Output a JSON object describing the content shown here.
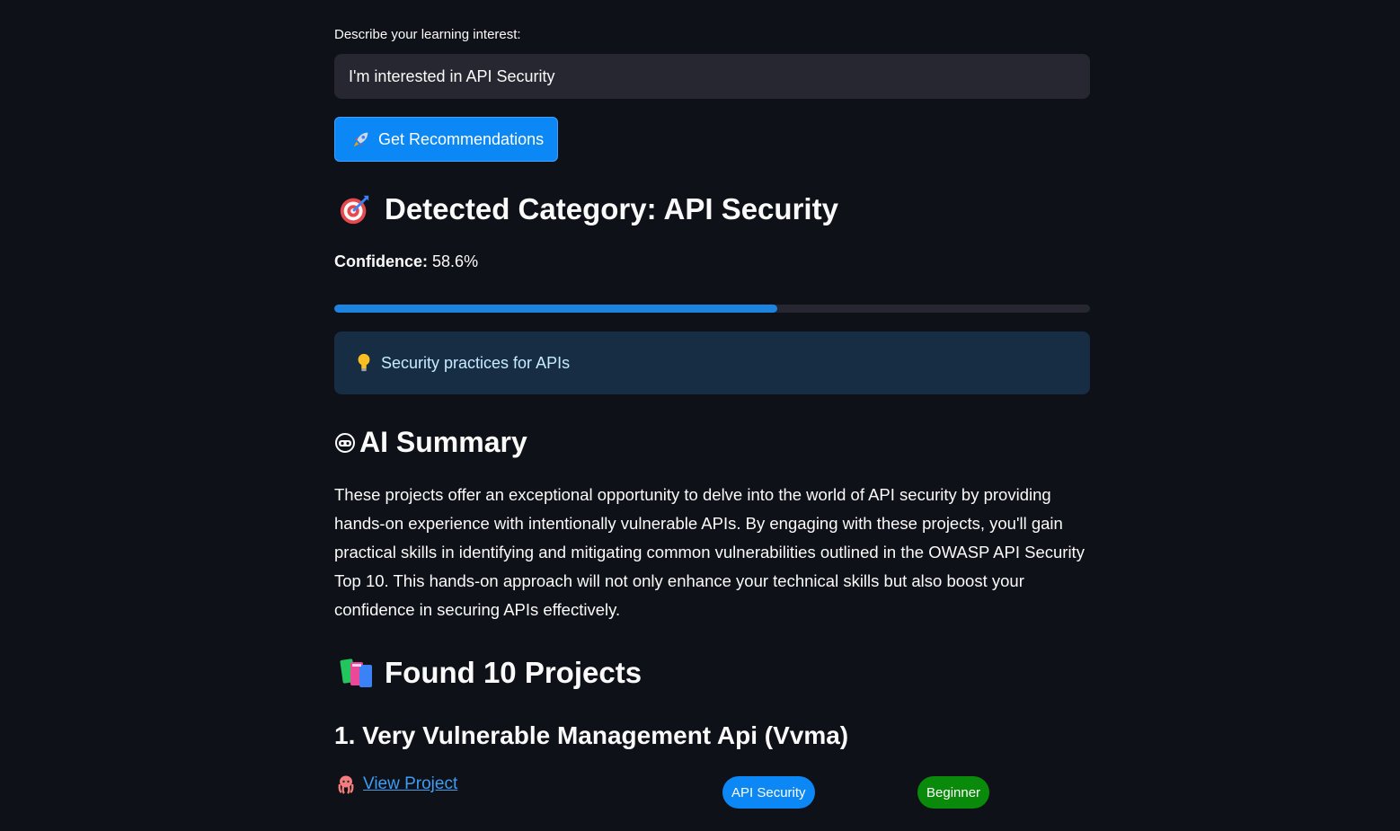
{
  "input": {
    "label": "Describe your learning interest:",
    "value": "I'm interested in API Security"
  },
  "action_button": {
    "icon": "rocket-icon",
    "label": "Get Recommendations"
  },
  "detected": {
    "icon": "target-icon",
    "heading": "Detected Category: API Security",
    "confidence_label": "Confidence:",
    "confidence_value": "58.6%",
    "confidence_fraction": 0.586
  },
  "info": {
    "icon": "lightbulb-icon",
    "text": "Security practices for APIs"
  },
  "summary": {
    "icon": "robot-icon",
    "heading": "AI Summary",
    "text": "These projects offer an exceptional opportunity to delve into the world of API security by providing hands-on experience with intentionally vulnerable APIs. By engaging with these projects, you'll gain practical skills in identifying and mitigating common vulnerabilities outlined in the OWASP API Security Top 10. This hands-on approach will not only enhance your technical skills but also boost your confidence in securing APIs effectively."
  },
  "results": {
    "icon": "books-icon",
    "heading": "Found 10 Projects",
    "projects": [
      {
        "title": "1. Very Vulnerable Management Api (Vvma)",
        "link_icon": "octopus-icon",
        "link_label": "View Project",
        "category_badge": "API Security",
        "level_badge": "Beginner"
      }
    ]
  },
  "colors": {
    "background": "#0e1117",
    "primary": "#0b87f6",
    "progress": "#1c83e1",
    "info_bg": "#172d43",
    "beginner_badge": "#0a8a0a",
    "link": "#3d9df3"
  }
}
